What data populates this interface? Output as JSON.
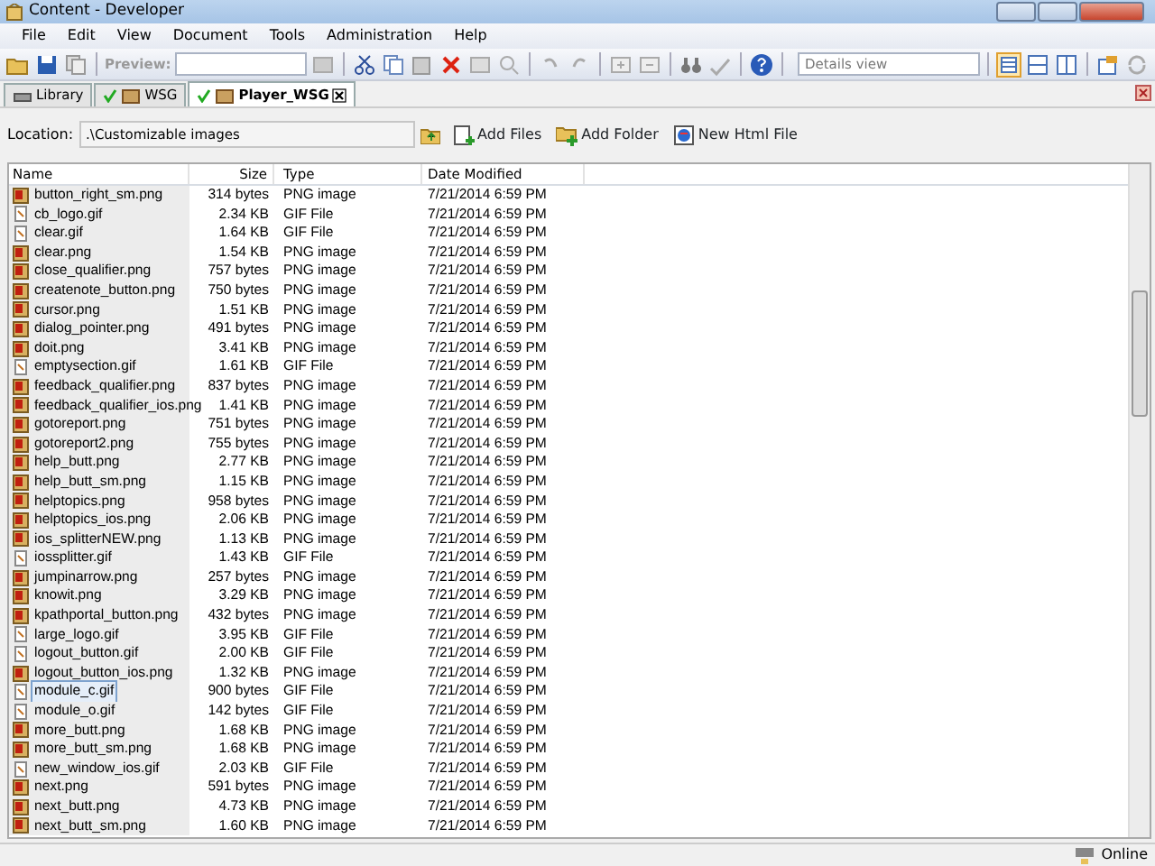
{
  "window": {
    "title": "Content - Developer"
  },
  "menu": [
    "File",
    "Edit",
    "View",
    "Document",
    "Tools",
    "Administration",
    "Help"
  ],
  "toolbar": {
    "preview_label": "Preview:",
    "view_combo": "Details view"
  },
  "tabs": [
    {
      "label": "Library",
      "selected": false,
      "checked": false
    },
    {
      "label": "WSG",
      "selected": false,
      "checked": true
    },
    {
      "label": "Player_WSG",
      "selected": true,
      "checked": true
    }
  ],
  "location": {
    "label": "Location:",
    "value": ".\\Customizable images"
  },
  "actions": [
    "Add Files",
    "Add Folder",
    "New Html File"
  ],
  "table": {
    "columns": [
      "Name",
      "Size",
      "Type",
      "Date Modified"
    ],
    "rows": [
      {
        "name": "button_right_sm.png",
        "size": "314 bytes",
        "type": "PNG image",
        "date": "7/21/2014 6:59 PM",
        "kind": "png",
        "selected": false
      },
      {
        "name": "cb_logo.gif",
        "size": "2.34 KB",
        "type": "GIF File",
        "date": "7/21/2014 6:59 PM",
        "kind": "gif",
        "selected": false
      },
      {
        "name": "clear.gif",
        "size": "1.64 KB",
        "type": "GIF File",
        "date": "7/21/2014 6:59 PM",
        "kind": "gif",
        "selected": false
      },
      {
        "name": "clear.png",
        "size": "1.54 KB",
        "type": "PNG image",
        "date": "7/21/2014 6:59 PM",
        "kind": "png",
        "selected": false
      },
      {
        "name": "close_qualifier.png",
        "size": "757 bytes",
        "type": "PNG image",
        "date": "7/21/2014 6:59 PM",
        "kind": "png",
        "selected": false
      },
      {
        "name": "createnote_button.png",
        "size": "750 bytes",
        "type": "PNG image",
        "date": "7/21/2014 6:59 PM",
        "kind": "png",
        "selected": false
      },
      {
        "name": "cursor.png",
        "size": "1.51 KB",
        "type": "PNG image",
        "date": "7/21/2014 6:59 PM",
        "kind": "png",
        "selected": false
      },
      {
        "name": "dialog_pointer.png",
        "size": "491 bytes",
        "type": "PNG image",
        "date": "7/21/2014 6:59 PM",
        "kind": "png",
        "selected": false
      },
      {
        "name": "doit.png",
        "size": "3.41 KB",
        "type": "PNG image",
        "date": "7/21/2014 6:59 PM",
        "kind": "png",
        "selected": false
      },
      {
        "name": "emptysection.gif",
        "size": "1.61 KB",
        "type": "GIF File",
        "date": "7/21/2014 6:59 PM",
        "kind": "gif",
        "selected": false
      },
      {
        "name": "feedback_qualifier.png",
        "size": "837 bytes",
        "type": "PNG image",
        "date": "7/21/2014 6:59 PM",
        "kind": "png",
        "selected": false
      },
      {
        "name": "feedback_qualifier_ios.png",
        "size": "1.41 KB",
        "type": "PNG image",
        "date": "7/21/2014 6:59 PM",
        "kind": "png",
        "selected": false
      },
      {
        "name": "gotoreport.png",
        "size": "751 bytes",
        "type": "PNG image",
        "date": "7/21/2014 6:59 PM",
        "kind": "png",
        "selected": false
      },
      {
        "name": "gotoreport2.png",
        "size": "755 bytes",
        "type": "PNG image",
        "date": "7/21/2014 6:59 PM",
        "kind": "png",
        "selected": false
      },
      {
        "name": "help_butt.png",
        "size": "2.77 KB",
        "type": "PNG image",
        "date": "7/21/2014 6:59 PM",
        "kind": "png",
        "selected": false
      },
      {
        "name": "help_butt_sm.png",
        "size": "1.15 KB",
        "type": "PNG image",
        "date": "7/21/2014 6:59 PM",
        "kind": "png",
        "selected": false
      },
      {
        "name": "helptopics.png",
        "size": "958 bytes",
        "type": "PNG image",
        "date": "7/21/2014 6:59 PM",
        "kind": "png",
        "selected": false
      },
      {
        "name": "helptopics_ios.png",
        "size": "2.06 KB",
        "type": "PNG image",
        "date": "7/21/2014 6:59 PM",
        "kind": "png",
        "selected": false
      },
      {
        "name": "ios_splitterNEW.png",
        "size": "1.13 KB",
        "type": "PNG image",
        "date": "7/21/2014 6:59 PM",
        "kind": "png",
        "selected": false
      },
      {
        "name": "iossplitter.gif",
        "size": "1.43 KB",
        "type": "GIF File",
        "date": "7/21/2014 6:59 PM",
        "kind": "gif",
        "selected": false
      },
      {
        "name": "jumpinarrow.png",
        "size": "257 bytes",
        "type": "PNG image",
        "date": "7/21/2014 6:59 PM",
        "kind": "png",
        "selected": false
      },
      {
        "name": "knowit.png",
        "size": "3.29 KB",
        "type": "PNG image",
        "date": "7/21/2014 6:59 PM",
        "kind": "png",
        "selected": false
      },
      {
        "name": "kpathportal_button.png",
        "size": "432 bytes",
        "type": "PNG image",
        "date": "7/21/2014 6:59 PM",
        "kind": "png",
        "selected": false
      },
      {
        "name": "large_logo.gif",
        "size": "3.95 KB",
        "type": "GIF File",
        "date": "7/21/2014 6:59 PM",
        "kind": "gif",
        "selected": false
      },
      {
        "name": "logout_button.gif",
        "size": "2.00 KB",
        "type": "GIF File",
        "date": "7/21/2014 6:59 PM",
        "kind": "gif",
        "selected": false
      },
      {
        "name": "logout_button_ios.png",
        "size": "1.32 KB",
        "type": "PNG image",
        "date": "7/21/2014 6:59 PM",
        "kind": "png",
        "selected": false
      },
      {
        "name": "module_c.gif",
        "size": "900 bytes",
        "type": "GIF File",
        "date": "7/21/2014 6:59 PM",
        "kind": "gif",
        "selected": true
      },
      {
        "name": "module_o.gif",
        "size": "142 bytes",
        "type": "GIF File",
        "date": "7/21/2014 6:59 PM",
        "kind": "gif",
        "selected": false
      },
      {
        "name": "more_butt.png",
        "size": "1.68 KB",
        "type": "PNG image",
        "date": "7/21/2014 6:59 PM",
        "kind": "png",
        "selected": false
      },
      {
        "name": "more_butt_sm.png",
        "size": "1.68 KB",
        "type": "PNG image",
        "date": "7/21/2014 6:59 PM",
        "kind": "png",
        "selected": false
      },
      {
        "name": "new_window_ios.gif",
        "size": "2.03 KB",
        "type": "GIF File",
        "date": "7/21/2014 6:59 PM",
        "kind": "gif",
        "selected": false
      },
      {
        "name": "next.png",
        "size": "591 bytes",
        "type": "PNG image",
        "date": "7/21/2014 6:59 PM",
        "kind": "png",
        "selected": false
      },
      {
        "name": "next_butt.png",
        "size": "4.73 KB",
        "type": "PNG image",
        "date": "7/21/2014 6:59 PM",
        "kind": "png",
        "selected": false
      },
      {
        "name": "next_butt_sm.png",
        "size": "1.60 KB",
        "type": "PNG image",
        "date": "7/21/2014 6:59 PM",
        "kind": "png",
        "selected": false
      }
    ]
  },
  "status_bar": {
    "text": "Online"
  }
}
